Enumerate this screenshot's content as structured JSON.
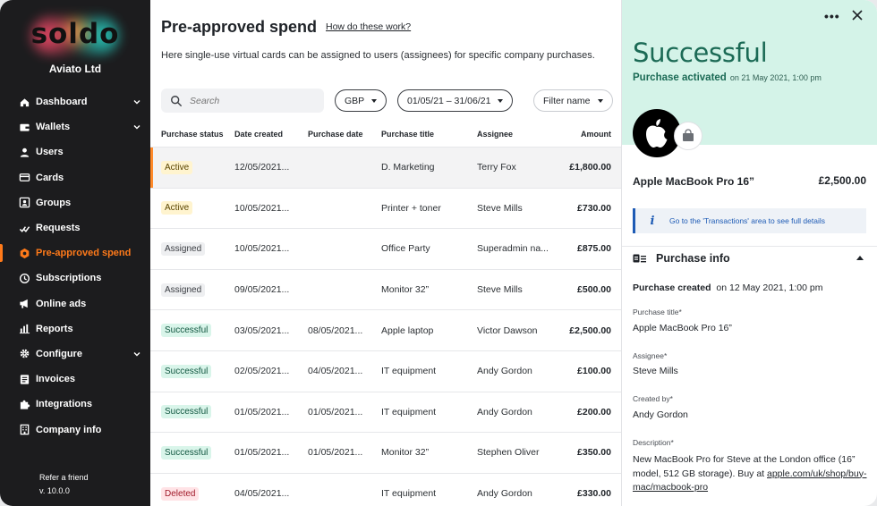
{
  "sidebar": {
    "logo_text": "soldo",
    "company": "Aviato Ltd",
    "items": [
      {
        "label": "Dashboard",
        "icon": "home-icon",
        "chevron": true
      },
      {
        "label": "Wallets",
        "icon": "wallet-icon",
        "chevron": true
      },
      {
        "label": "Users",
        "icon": "user-icon",
        "chevron": false
      },
      {
        "label": "Cards",
        "icon": "card-icon",
        "chevron": false
      },
      {
        "label": "Groups",
        "icon": "groups-icon",
        "chevron": false
      },
      {
        "label": "Requests",
        "icon": "requests-icon",
        "chevron": false
      },
      {
        "label": "Pre-approved spend",
        "icon": "pre-approved-icon",
        "chevron": false,
        "active": true
      },
      {
        "label": "Subscriptions",
        "icon": "subscriptions-icon",
        "chevron": false
      },
      {
        "label": "Online ads",
        "icon": "megaphone-icon",
        "chevron": false
      },
      {
        "label": "Reports",
        "icon": "reports-icon",
        "chevron": false
      },
      {
        "label": "Configure",
        "icon": "gear-icon",
        "chevron": true
      },
      {
        "label": "Invoices",
        "icon": "invoices-icon",
        "chevron": false
      },
      {
        "label": "Integrations",
        "icon": "puzzle-icon",
        "chevron": false
      },
      {
        "label": "Company info",
        "icon": "building-icon",
        "chevron": false
      }
    ],
    "refer": "Refer a friend",
    "version": "v. 10.0.0"
  },
  "main": {
    "title": "Pre-approved spend",
    "how_link": "How do these work?",
    "intro": "Here single-use virtual cards can be assigned to users (assignees) for specific company purchases.",
    "search_placeholder": "Search",
    "currency": "GBP",
    "date_range": "01/05/21 – 31/06/21",
    "filter_name": "Filter name",
    "columns": [
      "Purchase status",
      "Date created",
      "Purchase date",
      "Purchase title",
      "Assignee",
      "Amount"
    ],
    "rows": [
      {
        "status": "Active",
        "kind": "active",
        "created": "12/05/2021...",
        "purchased": "",
        "title": "D. Marketing",
        "assignee": "Terry Fox",
        "amount": "£1,800.00",
        "selected": true
      },
      {
        "status": "Active",
        "kind": "active",
        "created": "10/05/2021...",
        "purchased": "",
        "title": "Printer + toner",
        "assignee": "Steve Mills",
        "amount": "£730.00"
      },
      {
        "status": "Assigned",
        "kind": "assigned",
        "created": "10/05/2021...",
        "purchased": "",
        "title": "Office Party",
        "assignee": "Superadmin na...",
        "amount": "£875.00"
      },
      {
        "status": "Assigned",
        "kind": "assigned",
        "created": "09/05/2021...",
        "purchased": "",
        "title": "Monitor 32”",
        "assignee": "Steve Mills",
        "amount": "£500.00"
      },
      {
        "status": "Successful",
        "kind": "successful",
        "created": "03/05/2021...",
        "purchased": "08/05/2021...",
        "title": "Apple laptop",
        "assignee": "Victor Dawson",
        "amount": "£2,500.00"
      },
      {
        "status": "Successful",
        "kind": "successful",
        "created": "02/05/2021...",
        "purchased": "04/05/2021...",
        "title": "IT equipment",
        "assignee": "Andy Gordon",
        "amount": "£100.00"
      },
      {
        "status": "Successful",
        "kind": "successful",
        "created": "01/05/2021...",
        "purchased": "01/05/2021...",
        "title": "IT equipment",
        "assignee": "Andy Gordon",
        "amount": "£200.00"
      },
      {
        "status": "Successful",
        "kind": "successful",
        "created": "01/05/2021...",
        "purchased": "01/05/2021...",
        "title": "Monitor 32”",
        "assignee": "Stephen Oliver",
        "amount": "£350.00"
      },
      {
        "status": "Deleted",
        "kind": "deleted",
        "created": "04/05/2021...",
        "purchased": "",
        "title": "IT equipment",
        "assignee": "Andy Gordon",
        "amount": "£330.00"
      }
    ]
  },
  "panel": {
    "status": "Successful",
    "sub_status": "Purchase activated",
    "sub_date": "on 21 May 2021, 1:00 pm",
    "item_name": "Apple MacBook Pro 16”",
    "item_amount": "£2,500.00",
    "info_text": "Go to the 'Transactions' area to see full details",
    "section_title": "Purchase info",
    "created_label": "Purchase created",
    "created_value": "on 12 May 2021, 1:00 pm",
    "fields": [
      {
        "label": "Purchase title*",
        "value": "Apple MacBook Pro 16”"
      },
      {
        "label": "Assignee*",
        "value": "Steve Mills"
      },
      {
        "label": "Created by*",
        "value": "Andy Gordon"
      }
    ],
    "description_label": "Description*",
    "description_text": "New MacBook Pro for Steve at the London office (16” model, 512 GB storage). Buy at",
    "description_link": "apple.com/uk/shop/buy-mac/macbook-pro"
  },
  "colors": {
    "accent": "#ff7a1a",
    "panel_header": "#d4f3e8",
    "success_text": "#1b6a55",
    "sidebar_bg": "#1c1c1e"
  }
}
